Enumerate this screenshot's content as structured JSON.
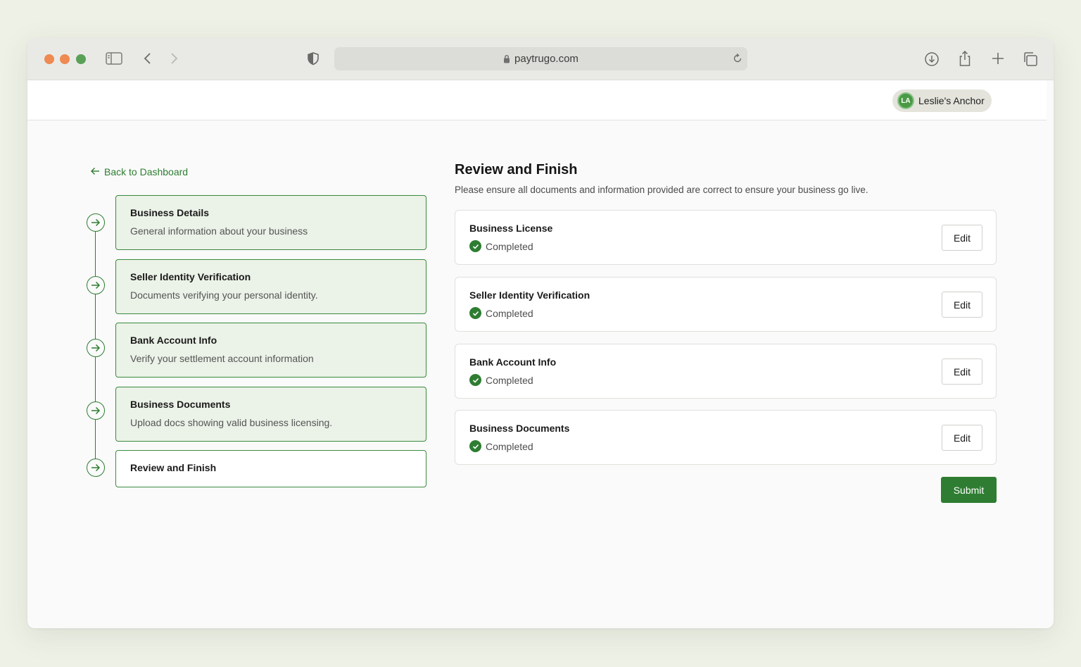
{
  "browser": {
    "url": "paytrugo.com"
  },
  "header": {
    "user_initials": "LA",
    "user_name": "Leslie's Anchor"
  },
  "nav": {
    "back_label": "Back to Dashboard"
  },
  "steps": [
    {
      "title": "Business Details",
      "description": "General information about your business"
    },
    {
      "title": "Seller Identity Verification",
      "description": "Documents verifying your personal identity."
    },
    {
      "title": "Bank Account Info",
      "description": "Verify your settlement account information"
    },
    {
      "title": "Business Documents",
      "description": "Upload docs showing valid business licensing."
    },
    {
      "title": "Review and Finish",
      "description": ""
    }
  ],
  "review": {
    "title": "Review and Finish",
    "subtitle": "Please ensure all documents and information provided are correct to ensure your business go live.",
    "items": [
      {
        "title": "Business License",
        "status": "Completed",
        "action": "Edit"
      },
      {
        "title": "Seller Identity Verification",
        "status": "Completed",
        "action": "Edit"
      },
      {
        "title": "Bank Account Info",
        "status": "Completed",
        "action": "Edit"
      },
      {
        "title": "Business Documents",
        "status": "Completed",
        "action": "Edit"
      }
    ],
    "submit_label": "Submit"
  },
  "colors": {
    "accent": "#2e7d32",
    "step_bg": "#ebf2e7",
    "page_bg": "#eef1e6"
  },
  "icons": {
    "traffic_lights": [
      "close-dot",
      "minimize-dot",
      "zoom-dot"
    ],
    "toolbar": [
      "sidebar-icon",
      "back-icon",
      "forward-icon",
      "shield-icon",
      "lock-icon",
      "reload-icon",
      "download-icon",
      "share-icon",
      "new-tab-icon",
      "tabs-icon"
    ],
    "steps": "arrow-right-circle-icon",
    "status": "check-circle-icon"
  }
}
